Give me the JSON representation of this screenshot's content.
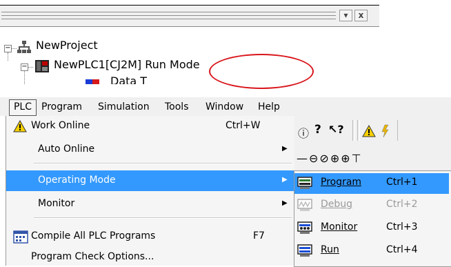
{
  "tree": {
    "root_label": "NewProject",
    "plc_label": "NewPLC1[CJ2M] Run Mode",
    "partial_child_label": "Data T",
    "pin_button": "▾",
    "close_button": "x"
  },
  "menubar": {
    "items": [
      "PLC",
      "Program",
      "Simulation",
      "Tools",
      "Window",
      "Help"
    ]
  },
  "plc_menu": {
    "work_online": {
      "label": "Work Online",
      "shortcut": "Ctrl+W"
    },
    "auto_online": {
      "label": "Auto Online"
    },
    "operating_mode": {
      "label": "Operating Mode"
    },
    "monitor": {
      "label": "Monitor"
    },
    "compile_all": {
      "label": "Compile All PLC Programs",
      "shortcut": "F7"
    },
    "check_options": {
      "label": "Program Check Options..."
    }
  },
  "operating_mode_submenu": [
    {
      "label": "Program",
      "shortcut": "Ctrl+1",
      "state": "selected"
    },
    {
      "label": "Debug",
      "shortcut": "Ctrl+2",
      "state": "disabled"
    },
    {
      "label": "Monitor",
      "shortcut": "Ctrl+3",
      "state": "enabled"
    },
    {
      "label": "Run",
      "shortcut": "Ctrl+4",
      "state": "enabled"
    }
  ],
  "colors": {
    "highlight": "#3399ff",
    "annotation_ellipse": "#d9151b",
    "menu_bg": "#f5f5f5"
  }
}
